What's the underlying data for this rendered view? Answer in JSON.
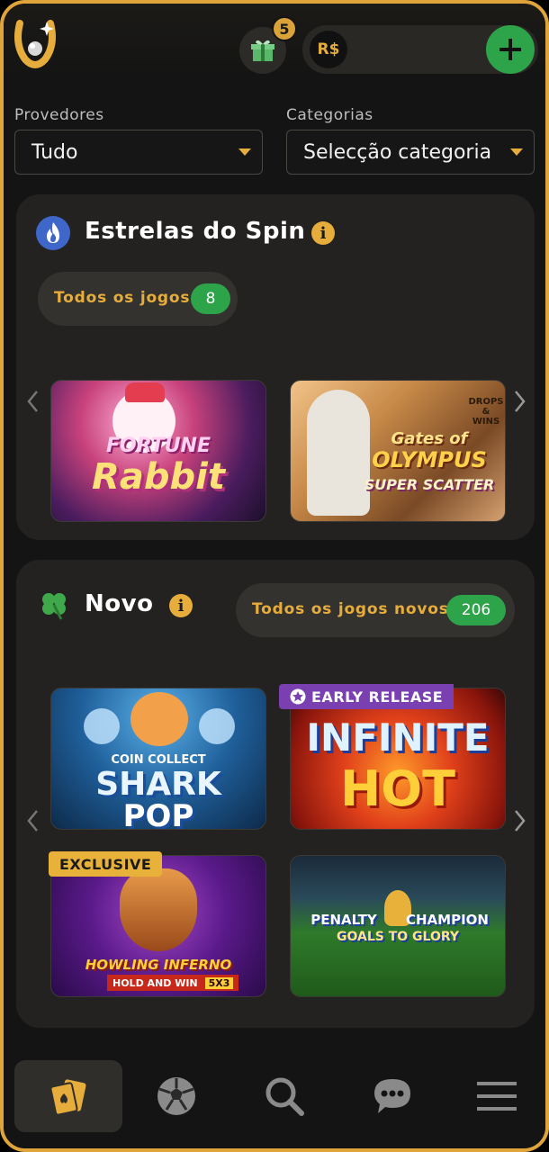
{
  "header": {
    "gift_count": "5",
    "currency_symbol": "R$"
  },
  "filters": {
    "providers_label": "Provedores",
    "providers_value": "Tudo",
    "categories_label": "Categorias",
    "categories_value": "Selecção categoria"
  },
  "spin_section": {
    "title": "Estrelas do Spin",
    "all_games_label": "Todos os jogos",
    "all_games_count": "8",
    "games": [
      {
        "title_line1": "FORTUNE",
        "title_line2": "Rabbit"
      },
      {
        "title_line1": "Gates of",
        "title_line2": "OLYMPUS",
        "subtitle": "SUPER SCATTER",
        "badge_line1": "DROPS",
        "badge_line2": "& WINS"
      }
    ]
  },
  "new_section": {
    "title": "Novo",
    "all_games_label": "Todos os jogos novos",
    "all_games_count": "206",
    "games": [
      {
        "title_line1": "COIN COLLECT",
        "title_line2": "SHARK",
        "title_line3": "POP"
      },
      {
        "ribbon": "EARLY RELEASE",
        "title_line1": "INFINITE",
        "title_line2": "HOT"
      },
      {
        "ribbon": "EXCLUSIVE",
        "title_line1": "HOWLING INFERNO",
        "title_line2": "HOLD AND WIN",
        "title_line3": "5X3"
      },
      {
        "title_line1": "PENALTY",
        "title_line2": "CHAMPION",
        "title_line3": "GOALS TO GLORY"
      }
    ]
  },
  "colors": {
    "accent": "#e7ad3c",
    "green": "#2ea44a",
    "panel": "#232220",
    "background": "#141414"
  },
  "nav": {
    "items": [
      "cards-icon",
      "soccer-ball-icon",
      "search-icon",
      "chat-icon",
      "menu-icon"
    ],
    "active": "cards-icon"
  }
}
